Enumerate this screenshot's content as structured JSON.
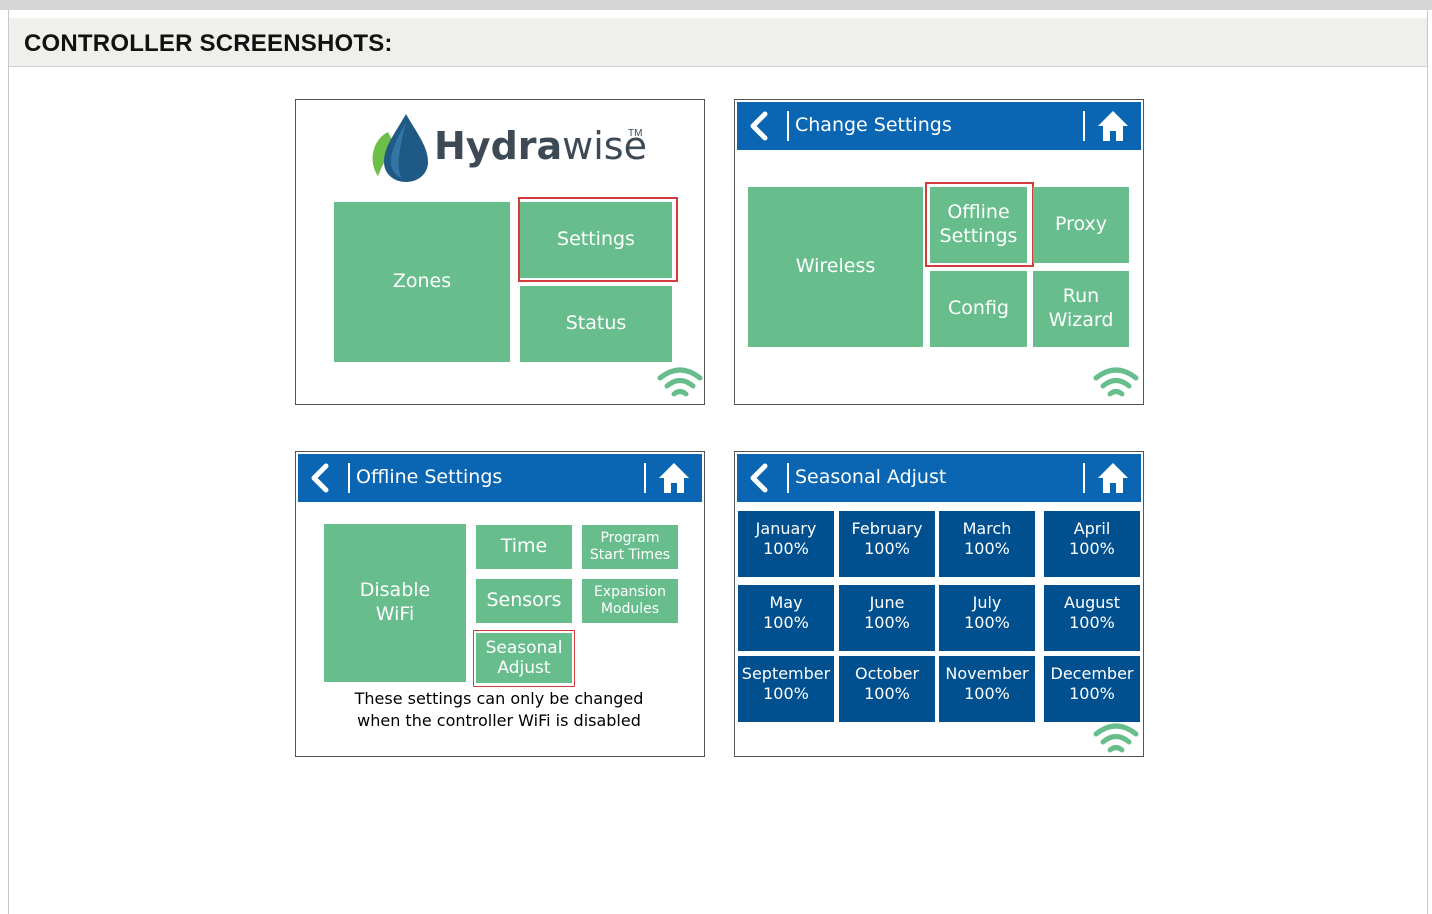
{
  "header": {
    "title": "CONTROLLER SCREENSHOTS:"
  },
  "screen_home": {
    "brand_bold": "Hydra",
    "brand_light": "wise",
    "tm": "TM",
    "tiles": {
      "zones": "Zones",
      "settings": "Settings",
      "status": "Status"
    }
  },
  "screen_change_settings": {
    "title": "Change Settings",
    "tiles": {
      "wireless": "Wireless",
      "offline": "Offline\nSettings",
      "proxy": "Proxy",
      "config": "Config",
      "run_wizard": "Run\nWizard"
    }
  },
  "screen_offline_settings": {
    "title": "Offline Settings",
    "tiles": {
      "disable_wifi": "Disable\nWiFi",
      "time": "Time",
      "sensors": "Sensors",
      "seasonal": "Seasonal\nAdjust",
      "program_start": "Program\nStart Times",
      "expansion": "Expansion\nModules"
    },
    "note_line1": "These settings can only be changed",
    "note_line2": "when the controller WiFi is disabled"
  },
  "screen_seasonal_adjust": {
    "title": "Seasonal Adjust",
    "months": [
      {
        "name": "January",
        "value": "100%"
      },
      {
        "name": "February",
        "value": "100%"
      },
      {
        "name": "March",
        "value": "100%"
      },
      {
        "name": "April",
        "value": "100%"
      },
      {
        "name": "May",
        "value": "100%"
      },
      {
        "name": "June",
        "value": "100%"
      },
      {
        "name": "July",
        "value": "100%"
      },
      {
        "name": "August",
        "value": "100%"
      },
      {
        "name": "September",
        "value": "100%"
      },
      {
        "name": "October",
        "value": "100%"
      },
      {
        "name": "November",
        "value": "100%"
      },
      {
        "name": "December",
        "value": "100%"
      }
    ]
  },
  "colors": {
    "tile_green": "#67be8c",
    "title_blue": "#0a66b3",
    "month_blue": "#004f8e",
    "highlight_red": "#d23c3c",
    "wifi_green": "#67be8c"
  }
}
